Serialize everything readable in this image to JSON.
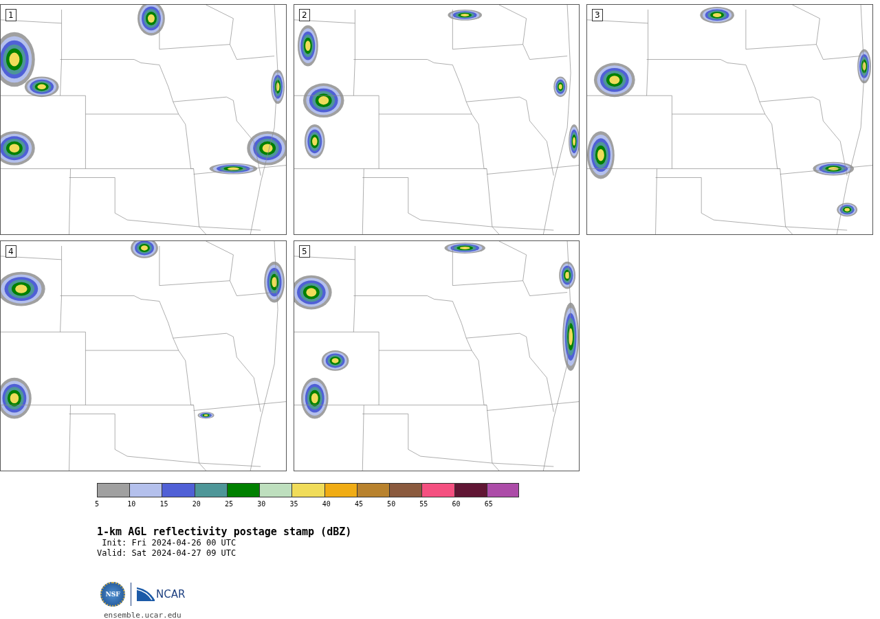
{
  "panels": [
    {
      "label": "1"
    },
    {
      "label": "2"
    },
    {
      "label": "3"
    },
    {
      "label": "4"
    },
    {
      "label": "5"
    }
  ],
  "colorbar": [
    {
      "color": "#a0a0a0",
      "label": "5"
    },
    {
      "color": "#b4c0ec",
      "label": "10"
    },
    {
      "color": "#5060d6",
      "label": "15"
    },
    {
      "color": "#4e9698",
      "label": "20"
    },
    {
      "color": "#008000",
      "label": "25"
    },
    {
      "color": "#bedfbe",
      "label": "30"
    },
    {
      "color": "#f0dc5a",
      "label": "35"
    },
    {
      "color": "#f0ac14",
      "label": "40"
    },
    {
      "color": "#b8822e",
      "label": "45"
    },
    {
      "color": "#8a5a3e",
      "label": "50"
    },
    {
      "color": "#f45080",
      "label": "55"
    },
    {
      "color": "#601634",
      "label": "60"
    },
    {
      "color": "#ac4ca8",
      "label": "65"
    }
  ],
  "title": "1-km AGL reflectivity postage stamp (dBZ)",
  "init": " Init: Fri 2024-04-26 00 UTC",
  "valid": "Valid: Sat 2024-04-27 09 UTC",
  "logos": {
    "nsf": "NSF",
    "ncar": "NCAR"
  },
  "site": "ensemble.ucar.edu"
}
